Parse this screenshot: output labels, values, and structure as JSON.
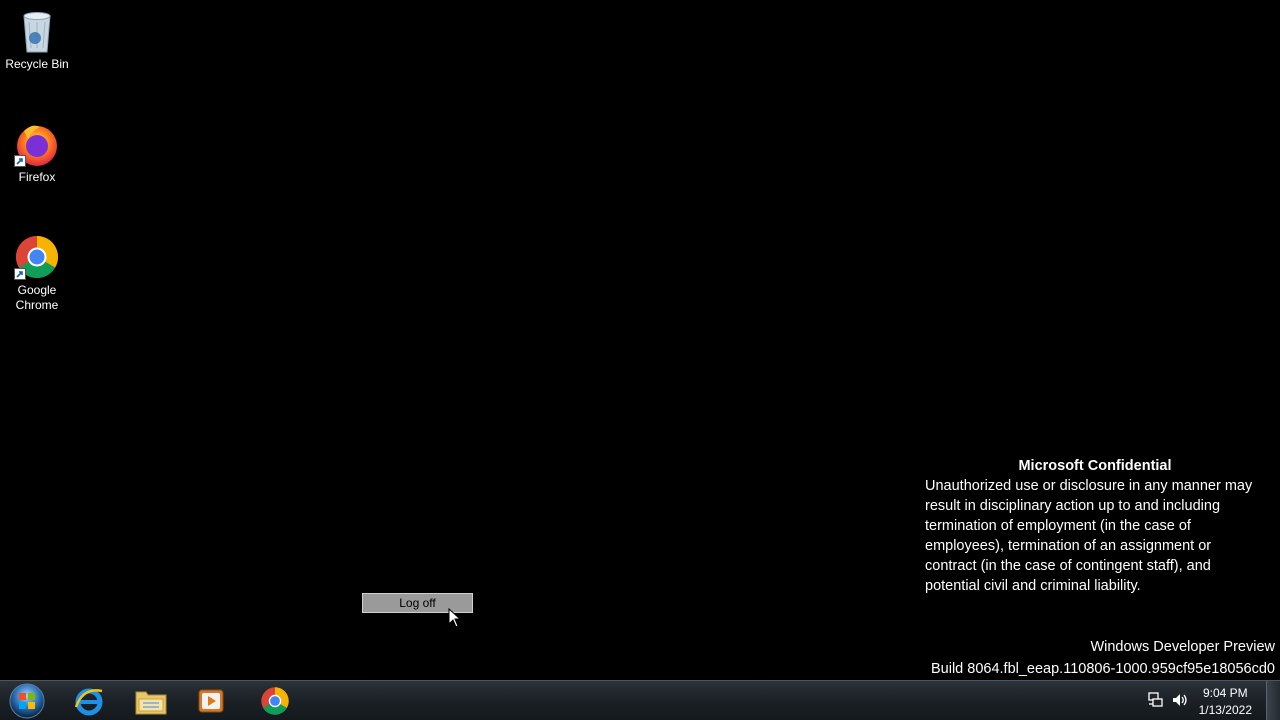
{
  "desktop": {
    "icons": [
      {
        "label": "Recycle Bin",
        "icon": "recycle-bin-icon"
      },
      {
        "label": "Firefox",
        "icon": "firefox-icon"
      },
      {
        "label": "Google\nChrome",
        "icon": "chrome-icon"
      }
    ]
  },
  "notice": {
    "title": "Microsoft Confidential",
    "body": "Unauthorized use or disclosure in any manner may result in disciplinary action up to and including termination of employment (in the case of employees), termination of an assignment or contract (in the case of contingent staff), and potential civil and criminal liability."
  },
  "watermark": {
    "line1": "Windows Developer Preview",
    "line2": "Build 8064.fbl_eeap.110806-1000.959cf95e18056cd0"
  },
  "logoff_label": "Log off",
  "taskbar": {
    "pinned": [
      "internet-explorer-icon",
      "file-explorer-icon",
      "media-player-icon",
      "chrome-icon"
    ],
    "tray": [
      "network-icon",
      "volume-icon"
    ],
    "clock_time": "9:04 PM",
    "clock_date": "1/13/2022"
  },
  "colors": {
    "desktop_bg": "#000000",
    "taskbar_bg": "#1b2126",
    "logoff_bg": "#9a9a9a"
  }
}
